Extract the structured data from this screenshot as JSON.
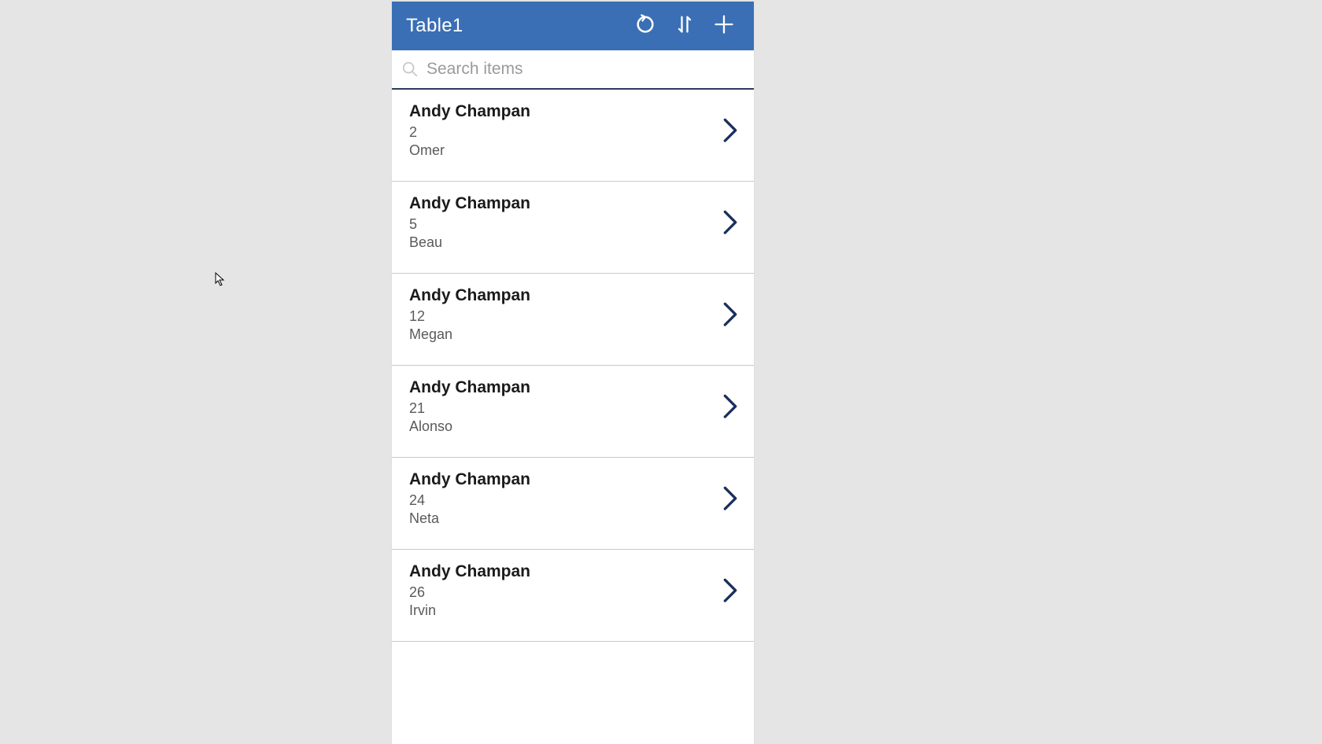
{
  "header": {
    "title": "Table1"
  },
  "search": {
    "placeholder": "Search items",
    "value": ""
  },
  "items": [
    {
      "title": "Andy Champan",
      "line2": "2",
      "line3": "Omer"
    },
    {
      "title": "Andy Champan",
      "line2": "5",
      "line3": "Beau"
    },
    {
      "title": "Andy Champan",
      "line2": "12",
      "line3": "Megan"
    },
    {
      "title": "Andy Champan",
      "line2": "21",
      "line3": "Alonso"
    },
    {
      "title": "Andy Champan",
      "line2": "24",
      "line3": "Neta"
    },
    {
      "title": "Andy Champan",
      "line2": "26",
      "line3": "Irvin"
    }
  ]
}
